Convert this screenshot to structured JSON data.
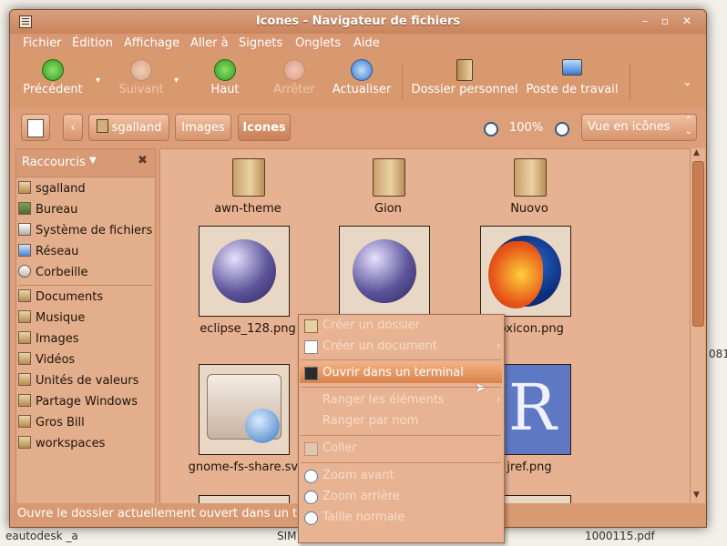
{
  "window": {
    "title": "Icones - Navigateur de fichiers"
  },
  "menubar": [
    "Fichier",
    "Édition",
    "Affichage",
    "Aller à",
    "Signets",
    "Onglets",
    "Aide"
  ],
  "toolbar": {
    "back": "Précédent",
    "forward": "Suivant",
    "up": "Haut",
    "stop": "Arrêter",
    "reload": "Actualiser",
    "home": "Dossier personnel",
    "desktop": "Poste de travail"
  },
  "location": {
    "path": [
      "sgalland",
      "Images",
      "Icones"
    ],
    "zoom": "100%",
    "view_mode": "Vue en icônes"
  },
  "sidebar": {
    "title": "Raccourcis",
    "places": [
      "sgalland",
      "Bureau",
      "Système de fichiers",
      "Réseau",
      "Corbeille"
    ],
    "bookmarks": [
      "Documents",
      "Musique",
      "Images",
      "Vidéos",
      "Unités de valeurs",
      "Partage Windows",
      "Gros Bill",
      "workspaces"
    ]
  },
  "files": [
    {
      "name": "awn-theme",
      "kind": "folder"
    },
    {
      "name": "Gion",
      "kind": "folder"
    },
    {
      "name": "Nuovo",
      "kind": "folder"
    },
    {
      "name": "eclipse_128.png",
      "kind": "image"
    },
    {
      "name": "",
      "kind": "image"
    },
    {
      "name": "foxicon.png",
      "kind": "image"
    },
    {
      "name": "gnome-fs-share.svg",
      "kind": "image"
    },
    {
      "name": "",
      "kind": "image"
    },
    {
      "name": "jref.png",
      "kind": "image"
    }
  ],
  "context_menu": {
    "items": [
      {
        "label": "Créer un dossier",
        "enabled": false,
        "submenu": false
      },
      {
        "label": "Créer un document",
        "enabled": false,
        "submenu": true
      },
      {
        "label": "Ouvrir dans un terminal",
        "enabled": true,
        "submenu": false,
        "highlighted": true
      },
      {
        "label": "Ranger les éléments",
        "enabled": false,
        "submenu": true
      },
      {
        "label": "Ranger par nom",
        "enabled": false,
        "submenu": false
      },
      {
        "label": "Coller",
        "enabled": false,
        "submenu": false
      },
      {
        "label": "Zoom avant",
        "enabled": false,
        "submenu": false
      },
      {
        "label": "Zoom arrière",
        "enabled": false,
        "submenu": false
      },
      {
        "label": "Taille normale",
        "enabled": false,
        "submenu": false
      }
    ]
  },
  "status_bar": {
    "text": "Ouvre le dossier actuellement ouvert dans un te"
  },
  "desktop": {
    "items": [
      "eautodesk _a",
      "SIM",
      "1000115.pdf",
      "081"
    ]
  },
  "colors": {
    "accent": "#d9996f",
    "highlight": "#e08a55"
  }
}
